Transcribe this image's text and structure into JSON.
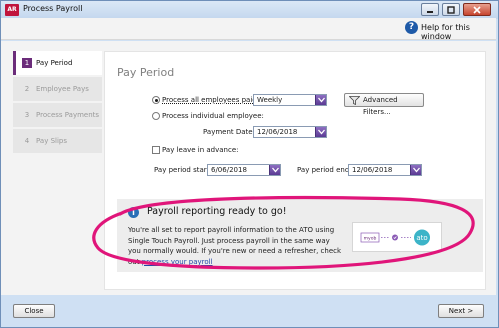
{
  "window": {
    "app_badge": "AR",
    "title": "Process Payroll",
    "help_label": "Help for this window"
  },
  "steps": [
    {
      "num": "1",
      "label": "Pay Period",
      "active": true
    },
    {
      "num": "2",
      "label": "Employee Pays",
      "active": false
    },
    {
      "num": "3",
      "label": "Process Payments",
      "active": false
    },
    {
      "num": "4",
      "label": "Pay Slips",
      "active": false
    }
  ],
  "pay_period": {
    "title": "Pay Period",
    "all_employees_label": "Process all employees paid:",
    "frequency_value": "Weekly",
    "advanced_filters_label": "Advanced Filters...",
    "individual_label": "Process individual employee:",
    "payment_date_label": "Payment Date:",
    "payment_date_value": "12/06/2018",
    "pay_leave_label": "Pay leave in advance:",
    "period_start_label": "Pay period start:",
    "period_start_value": "6/06/2018",
    "period_end_label": "Pay period end:",
    "period_end_value": "12/06/2018"
  },
  "banner": {
    "title": "Payroll reporting ready to go!",
    "text": "You're all set to report payroll information to the ATO using Single Touch Payroll. Just process payroll in the same way you normally would. If you're new or need a refresher, check out",
    "link": "process your payroll",
    "graphic_left": "myob",
    "graphic_right": "ato"
  },
  "footer": {
    "close_label": "Close",
    "next_label": "Next >"
  },
  "colors": {
    "accent_purple": "#6b2c7a",
    "highlight_magenta": "#e0157a",
    "info_blue": "#2a6fb6"
  }
}
